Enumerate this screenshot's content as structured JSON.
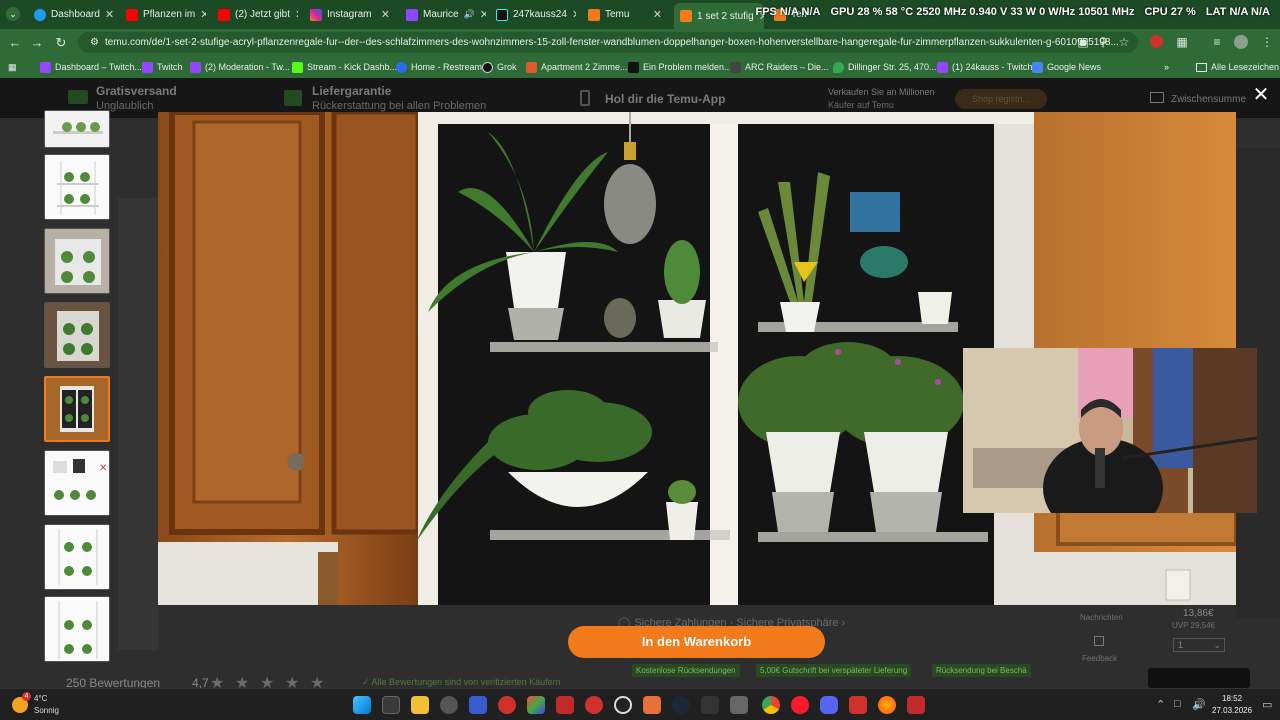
{
  "browser": {
    "tabs": [
      {
        "label": "Dashboard",
        "color": "#1d9bf0"
      },
      {
        "label": "Pflanzen im",
        "color": "#ff0000"
      },
      {
        "label": "(2) Jetzt gibt",
        "color": "#ff0000"
      },
      {
        "label": "Instagram",
        "color": "#d6249f"
      },
      {
        "label": "Maurice",
        "color": "#9146ff"
      },
      {
        "label": "247kauss24",
        "color": "#111111"
      },
      {
        "label": "Temu",
        "color": "#f27a1a"
      },
      {
        "label": "1 set 2 stufig",
        "color": "#f27a1a"
      },
      {
        "label": "Temu",
        "color": "#f27a1a"
      }
    ],
    "overlay_stats": [
      "FPS N/A N/A",
      "GPU 28 % 58 °C 2520 MHz 0.940 V 33 W 0 W/Hz 10501 MHz",
      "CPU 27 %",
      "LAT N/A N/A"
    ],
    "url": "temu.com/de/1-set-2-stufige-acryl-pflanzenregale-fur--der--des-schlafzimmers-des-wohnzimmers-15-zoll-fenster-wandblumen-doppelhanger-boxen-hohenverstellbare-hangeregale-fur-zimmerpflanzen-sukkulenten-g-6010995198...",
    "bookmarks": [
      {
        "label": "Dashboard – Twitch...",
        "color": "#9146ff"
      },
      {
        "label": "Twitch",
        "color": "#9146ff"
      },
      {
        "label": "(2) Moderation - Tw...",
        "color": "#9146ff"
      },
      {
        "label": "Stream - Kick Dashb...",
        "color": "#53fc18"
      },
      {
        "label": "Home - Restream",
        "color": "#2a6ef0"
      },
      {
        "label": "Grok",
        "color": "#111111"
      },
      {
        "label": "Apartment 2 Zimme...",
        "color": "#e05a2b"
      },
      {
        "label": "Ein Problem melden...",
        "color": "#111111"
      },
      {
        "label": "ARC Raiders – Die...",
        "color": "#444444"
      },
      {
        "label": "Dillinger Str. 25, 470...",
        "color": "#34a853"
      },
      {
        "label": "(1) 24kauss - Twitch",
        "color": "#9146ff"
      },
      {
        "label": "Google News",
        "color": "#4285f4"
      }
    ],
    "bookmarks_all": "Alle Lesezeichen"
  },
  "page": {
    "strip": {
      "shipping": "Gratisversand",
      "shipping_sub": "Unglaublich",
      "guarantee": "Liefergarantie",
      "guarantee_sub": "Rückerstattung bei allen Problemen",
      "app": "Hol dir die Temu-App",
      "sell": "Verkaufen Sie an Millionen",
      "sell_sub": "Käufer auf Temu",
      "shop_btn": "Shop registri...",
      "cart_sum": "Zwischensumme"
    },
    "cart_button": "In den Warenkorb",
    "secure_payment": "Sichere Zahlungen · Sichere Privatsphäre",
    "promos": [
      "Kostenlose Rücksendungen",
      "5,00€ Gutschrift bei verspäteter Lieferung",
      "Rücksendung bei Beschä"
    ],
    "reviews": "250 Bewertungen",
    "rating": "4,7",
    "verified": "Alle Bewertungen sind von verifizierten Käufern",
    "price": "13,86€",
    "price_old": "UVP 29,54€",
    "qty": "1",
    "side_links": [
      "Nachrichten",
      "Feedback"
    ]
  },
  "taskbar": {
    "weather_temp": "4°C",
    "weather_cond": "Sonnig",
    "time": "18:52",
    "date": "27.03.2026",
    "notification_count": "4"
  }
}
